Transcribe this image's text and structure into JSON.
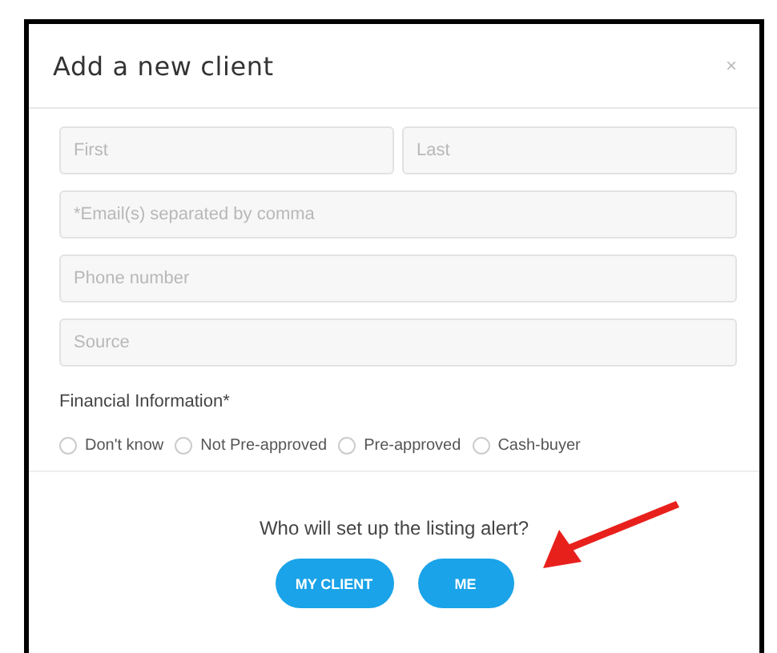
{
  "dialog": {
    "title": "Add a new client",
    "close": "×"
  },
  "fields": [
    {
      "placeholder": "First"
    },
    {
      "placeholder": "Last"
    },
    {
      "placeholder": "*Email(s) separated by comma"
    },
    {
      "placeholder": "Phone number"
    },
    {
      "placeholder": "Source"
    }
  ],
  "financial": {
    "label": "Financial Information*",
    "options": [
      {
        "label": "Don't know",
        "selected": false
      },
      {
        "label": "Not Pre-approved",
        "selected": false
      },
      {
        "label": "Pre-approved",
        "selected": false
      },
      {
        "label": "Cash-buyer",
        "selected": false
      }
    ]
  },
  "question": "Who will set up the listing alert?",
  "buttons": [
    "MY CLIENT",
    "ME"
  ]
}
